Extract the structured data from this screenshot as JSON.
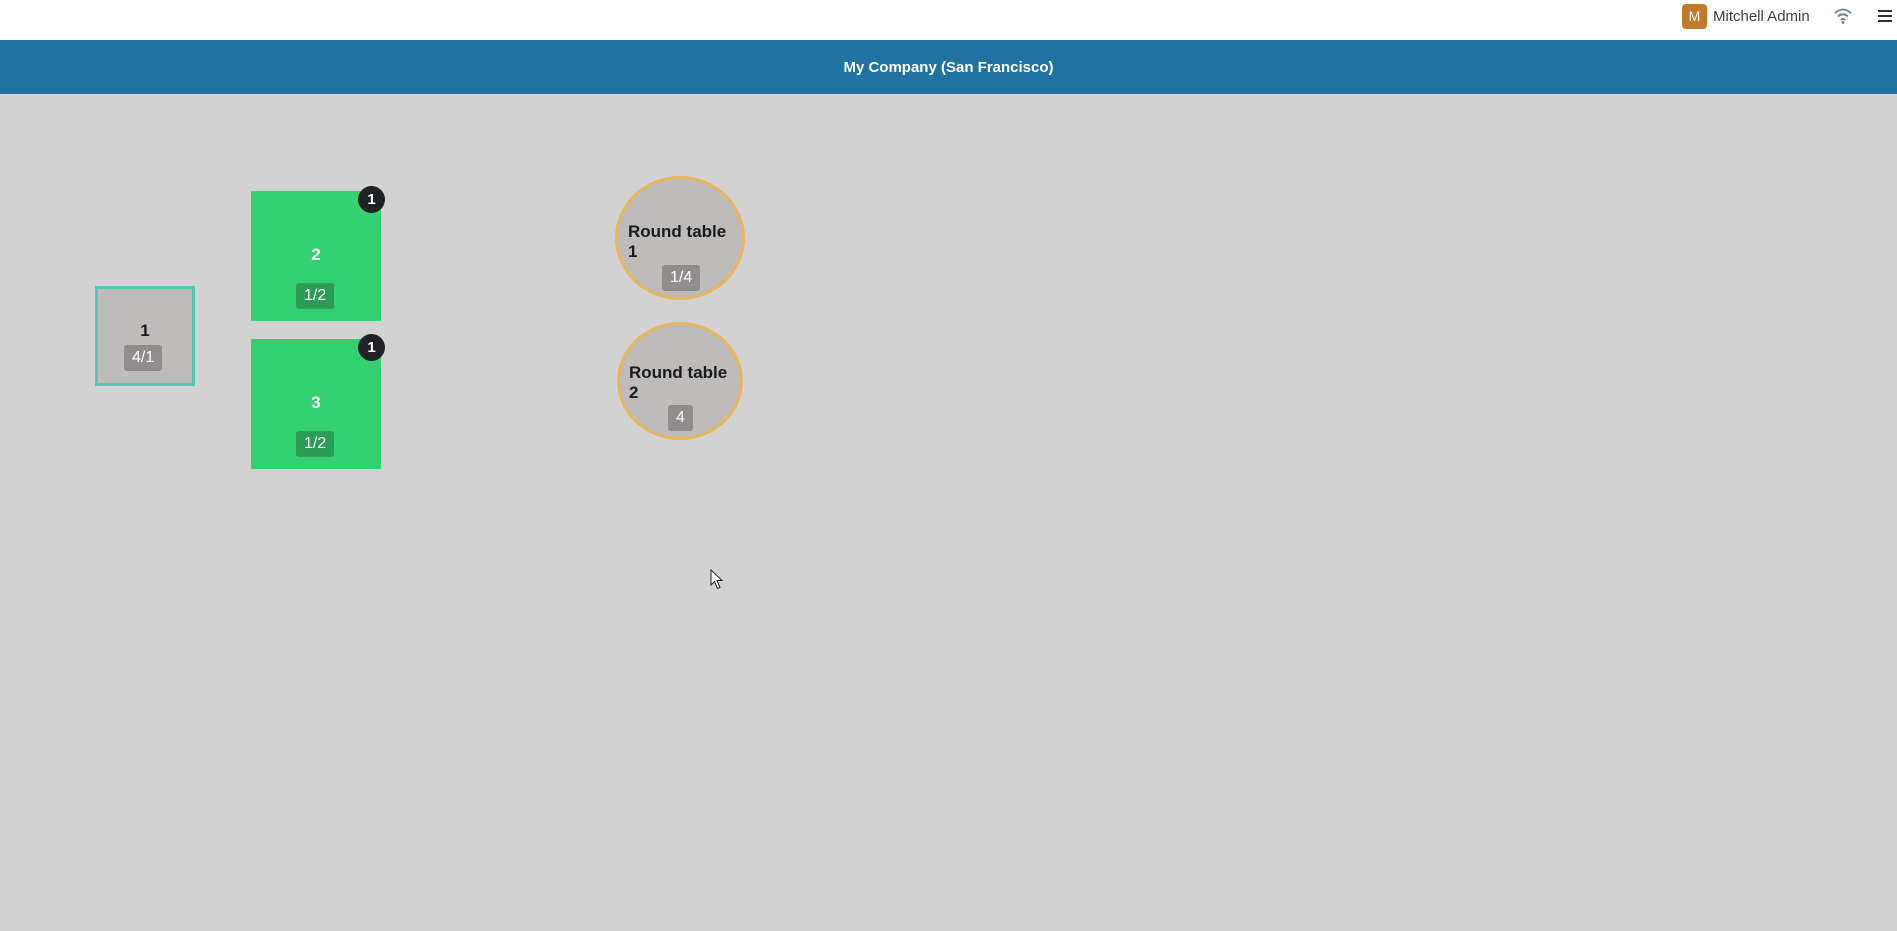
{
  "topbar": {
    "user_initial": "M",
    "user_name": "Mitchell Admin",
    "wifi_icon": "wifi-icon",
    "menu_icon": "hamburger-menu-icon"
  },
  "company": {
    "name": "My Company (San Francisco)"
  },
  "colors": {
    "header_blue": "#2072a0",
    "occupied_green": "#33d171",
    "free_gray": "#bdbcbb",
    "selected_border": "#53c7ba",
    "round_border": "#e8b65b",
    "avatar_orange": "#c1792c"
  },
  "tables": [
    {
      "name": "1",
      "seats": "4/1",
      "state": "free",
      "selected": true
    },
    {
      "name": "2",
      "seats": "1/2",
      "state": "occupied",
      "orders": "1"
    },
    {
      "name": "3",
      "seats": "1/2",
      "state": "occupied",
      "orders": "1"
    },
    {
      "name": "Round table 1",
      "seats": "1/4",
      "state": "free",
      "shape": "round"
    },
    {
      "name": "Round table 2",
      "seats": "4",
      "state": "free",
      "shape": "round"
    }
  ]
}
